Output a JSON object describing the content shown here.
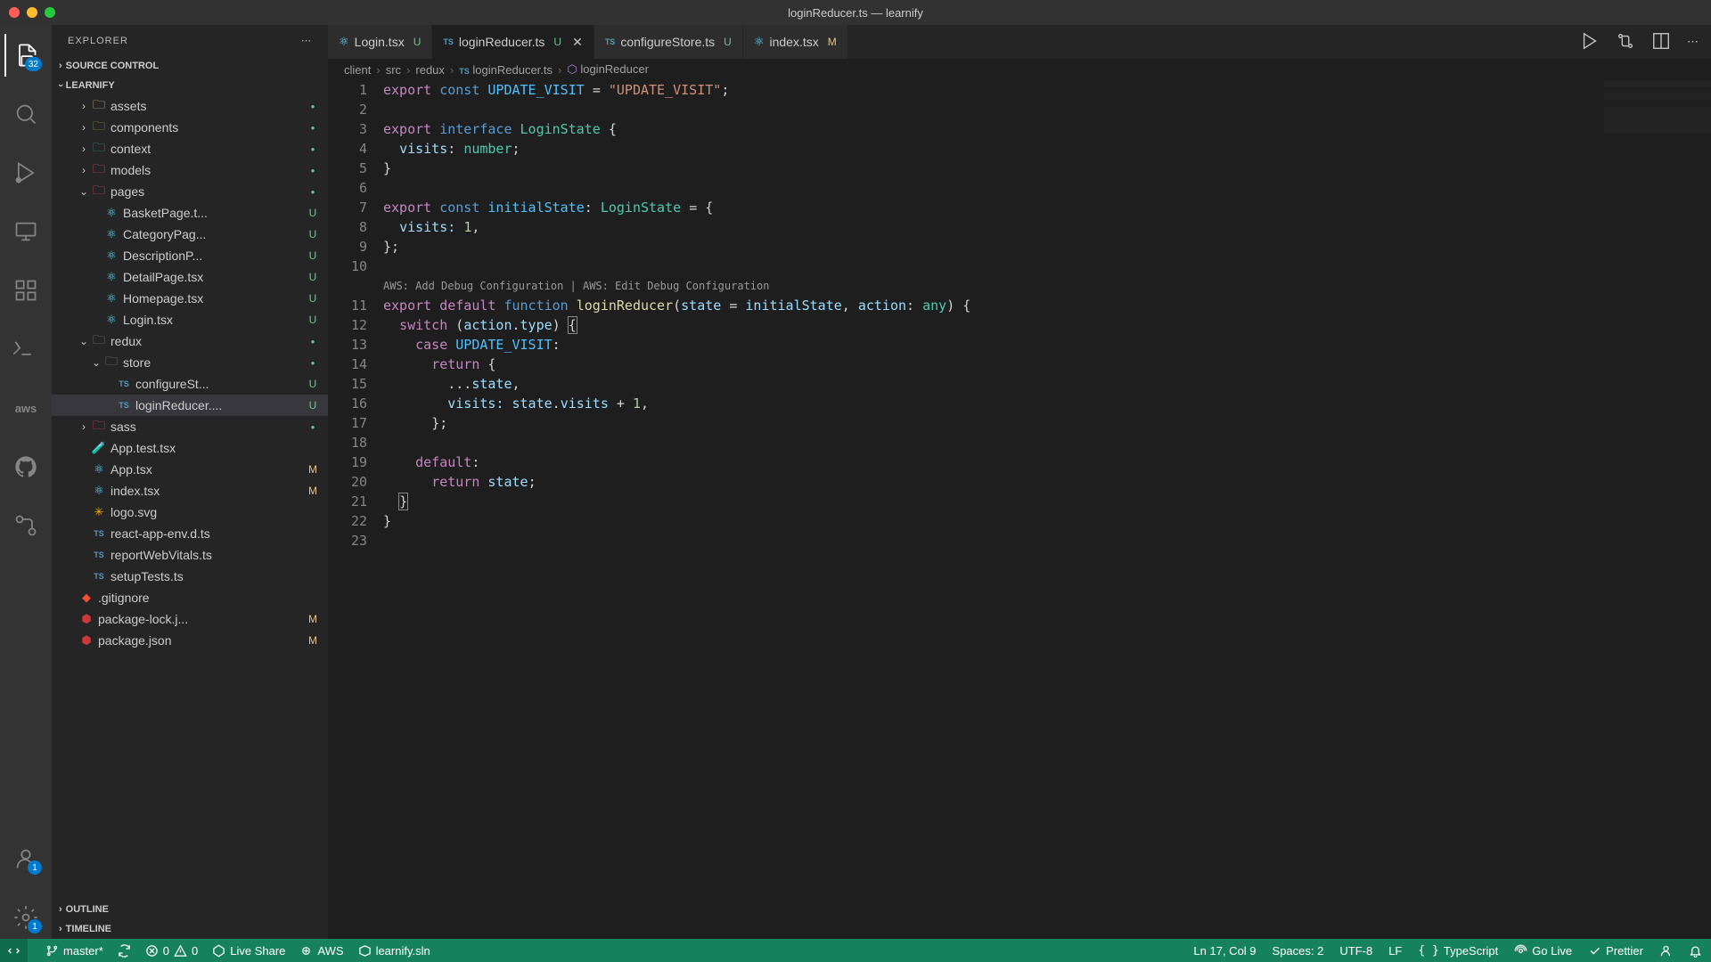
{
  "window": {
    "title": "loginReducer.ts — learnify"
  },
  "sidebar": {
    "header": "EXPLORER",
    "sections": {
      "source_control": "SOURCE CONTROL",
      "project": "LEARNIFY",
      "outline": "OUTLINE",
      "timeline": "TIMELINE"
    },
    "tree": [
      {
        "label": "assets",
        "indent": 2,
        "folder": true,
        "collapsed": true,
        "color": "#e2c08d",
        "dot": true
      },
      {
        "label": "components",
        "indent": 2,
        "folder": true,
        "collapsed": true,
        "color": "#7cb342",
        "dot": true
      },
      {
        "label": "context",
        "indent": 2,
        "folder": true,
        "collapsed": true,
        "color": "#26a69a",
        "dot": true
      },
      {
        "label": "models",
        "indent": 2,
        "folder": true,
        "collapsed": true,
        "color": "#ef5350",
        "dot": true
      },
      {
        "label": "pages",
        "indent": 2,
        "folder": true,
        "collapsed": false,
        "color": "#ef5350",
        "dot": true
      },
      {
        "label": "BasketPage.t...",
        "indent": 3,
        "folder": false,
        "icon": "react",
        "status": "U"
      },
      {
        "label": "CategoryPag...",
        "indent": 3,
        "folder": false,
        "icon": "react",
        "status": "U"
      },
      {
        "label": "DescriptionP...",
        "indent": 3,
        "folder": false,
        "icon": "react",
        "status": "U"
      },
      {
        "label": "DetailPage.tsx",
        "indent": 3,
        "folder": false,
        "icon": "react",
        "status": "U"
      },
      {
        "label": "Homepage.tsx",
        "indent": 3,
        "folder": false,
        "icon": "react",
        "status": "U"
      },
      {
        "label": "Login.tsx",
        "indent": 3,
        "folder": false,
        "icon": "react",
        "status": "U"
      },
      {
        "label": "redux",
        "indent": 2,
        "folder": true,
        "collapsed": false,
        "color": "#888",
        "dot": true
      },
      {
        "label": "store",
        "indent": 3,
        "folder": true,
        "collapsed": false,
        "color": "#888",
        "dot": true
      },
      {
        "label": "configureSt...",
        "indent": 4,
        "folder": false,
        "icon": "ts",
        "status": "U"
      },
      {
        "label": "loginReducer....",
        "indent": 4,
        "folder": false,
        "icon": "ts",
        "status": "U",
        "selected": true
      },
      {
        "label": "sass",
        "indent": 2,
        "folder": true,
        "collapsed": true,
        "color": "#ec407a",
        "dot": true
      },
      {
        "label": "App.test.tsx",
        "indent": 2,
        "folder": false,
        "icon": "test"
      },
      {
        "label": "App.tsx",
        "indent": 2,
        "folder": false,
        "icon": "react",
        "status": "M"
      },
      {
        "label": "index.tsx",
        "indent": 2,
        "folder": false,
        "icon": "react",
        "status": "M"
      },
      {
        "label": "logo.svg",
        "indent": 2,
        "folder": false,
        "icon": "svg"
      },
      {
        "label": "react-app-env.d.ts",
        "indent": 2,
        "folder": false,
        "icon": "ts"
      },
      {
        "label": "reportWebVitals.ts",
        "indent": 2,
        "folder": false,
        "icon": "ts"
      },
      {
        "label": "setupTests.ts",
        "indent": 2,
        "folder": false,
        "icon": "ts"
      },
      {
        "label": ".gitignore",
        "indent": 1,
        "folder": false,
        "icon": "git"
      },
      {
        "label": "package-lock.j...",
        "indent": 1,
        "folder": false,
        "icon": "npm",
        "status": "M"
      },
      {
        "label": "package.json",
        "indent": 1,
        "folder": false,
        "icon": "npm",
        "status": "M"
      }
    ]
  },
  "activity": {
    "explorer_badge": "32",
    "account_badge": "1",
    "settings_badge": "1"
  },
  "tabs": [
    {
      "label": "Login.tsx",
      "icon": "react",
      "status": "U"
    },
    {
      "label": "loginReducer.ts",
      "icon": "ts",
      "status": "U",
      "active": true,
      "close": true
    },
    {
      "label": "configureStore.ts",
      "icon": "ts",
      "status": "U"
    },
    {
      "label": "index.tsx",
      "icon": "react",
      "status": "M"
    }
  ],
  "breadcrumb": [
    "client",
    "src",
    "redux",
    "loginReducer.ts",
    "loginReducer"
  ],
  "codelens": "AWS: Add Debug Configuration | AWS: Edit Debug Configuration",
  "code_lines": 23,
  "statusbar": {
    "branch": "master*",
    "errors": "0",
    "warnings": "0",
    "liveshare": "Live Share",
    "aws": "AWS",
    "solution": "learnify.sln",
    "cursor": "Ln 17, Col 9",
    "spaces": "Spaces: 2",
    "encoding": "UTF-8",
    "eol": "LF",
    "language": "TypeScript",
    "golive": "Go Live",
    "prettier": "Prettier"
  }
}
